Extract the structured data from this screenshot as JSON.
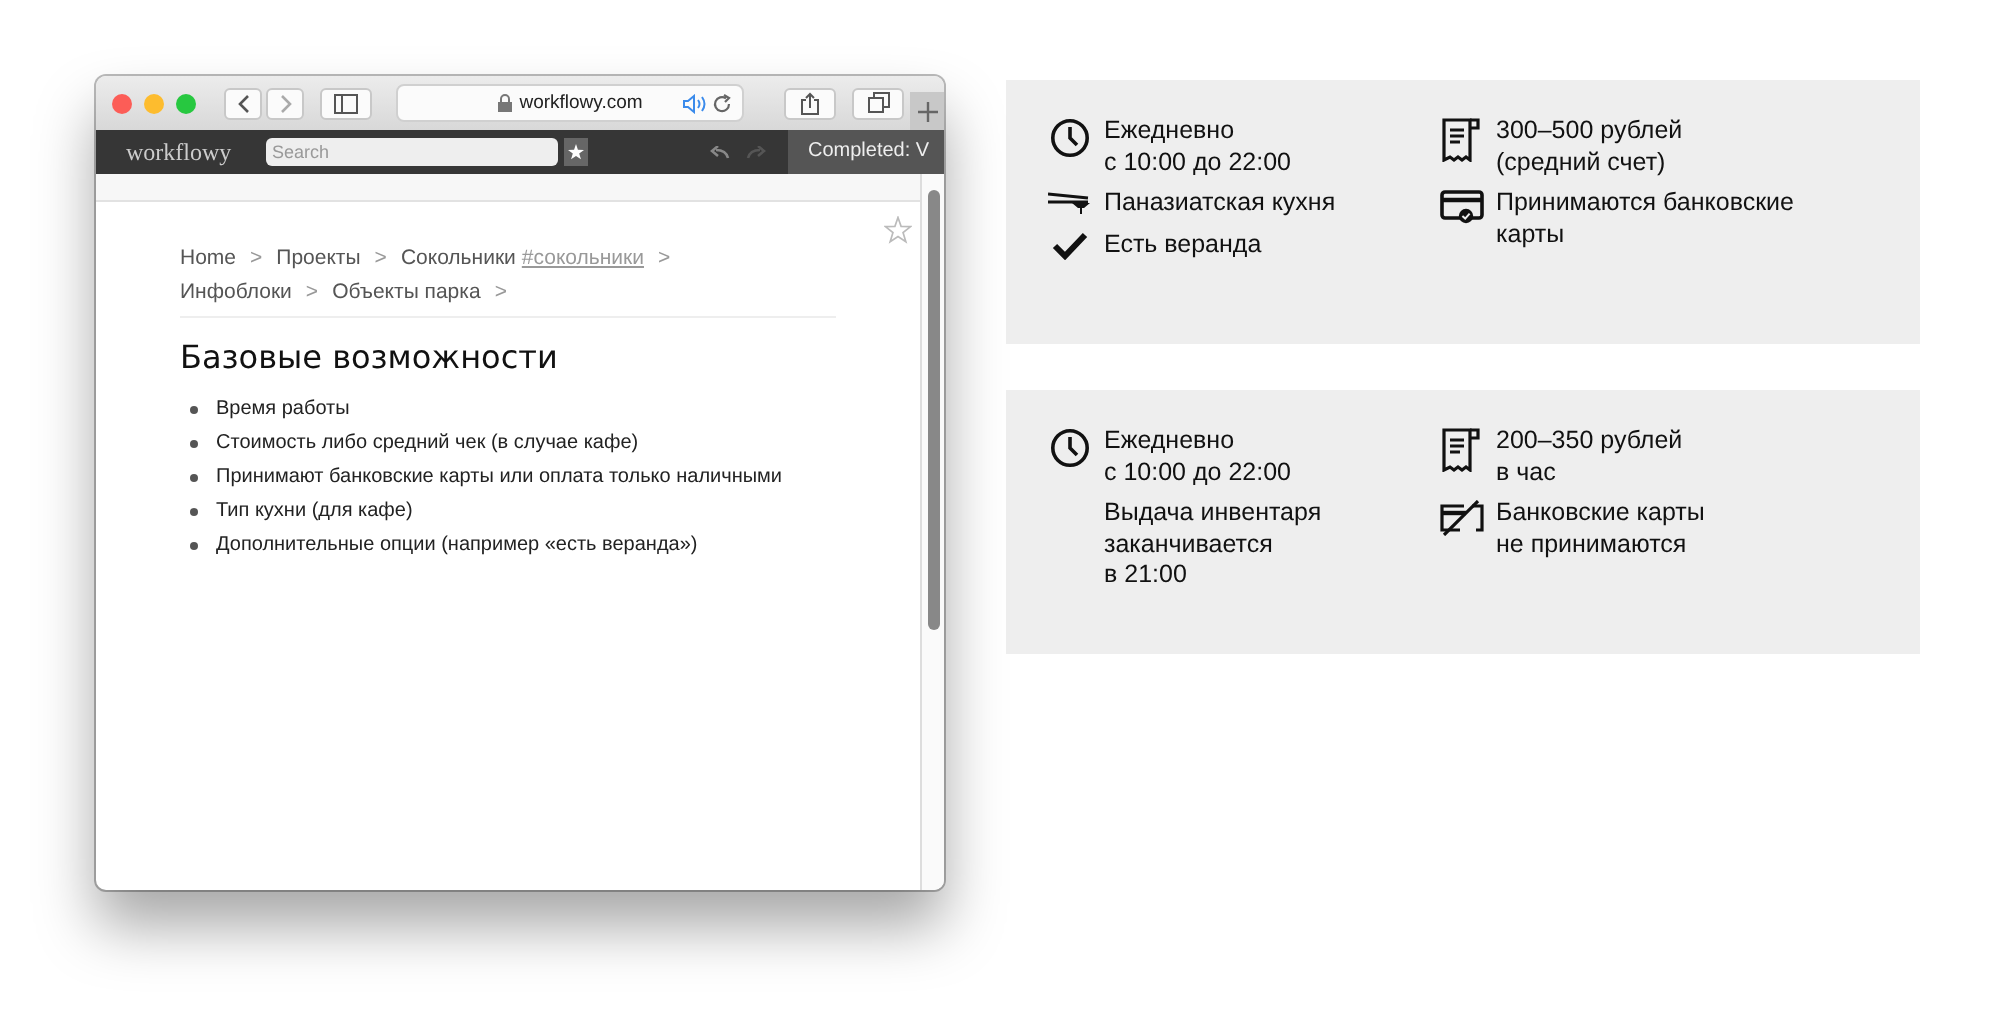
{
  "browser": {
    "url": "workflowy.com",
    "app_name": "workflowy",
    "search_placeholder": "Search",
    "completed_label": "Completed: V",
    "breadcrumb_lines": [
      [
        {
          "label": "Home",
          "sep": ">"
        },
        {
          "label": "Проекты",
          "sep": ">"
        },
        {
          "label": "Сокольники",
          "tag": "#сокольники",
          "sep": ">"
        }
      ],
      [
        {
          "label": "Инфоблоки",
          "sep": ">"
        },
        {
          "label": "Объекты парка",
          "sep": ">"
        }
      ]
    ],
    "title": "Базовые возможности",
    "bullets": [
      "Время работы",
      "Стоимость либо средний чек (в случае кафе)",
      "Принимают банковские карты или оплата только наличными",
      "Тип кухни (для кафе)",
      "Дополнительные опции (например «есть веранда»)"
    ]
  },
  "cards": [
    {
      "columns": [
        [
          {
            "kind": "clock",
            "text": "Ежедневно\nс 10:00 до 22:00"
          },
          {
            "kind": "cuisine",
            "text": "Паназиатская кухня"
          },
          {
            "kind": "check",
            "text": "Есть веранда"
          }
        ],
        [
          {
            "kind": "receipt",
            "text": "300–500 рублей\n(средний счет)"
          },
          {
            "kind": "card",
            "text": "Принимаются банковские\nкарты"
          }
        ]
      ]
    },
    {
      "columns": [
        [
          {
            "kind": "clock",
            "text": "Ежедневно\nс 10:00 до 22:00"
          },
          {
            "kind": "none",
            "text": "Выдача инвентаря\nзаканчивается\nв 21:00"
          }
        ],
        [
          {
            "kind": "receipt",
            "text": "200–350 рублей\nв час"
          },
          {
            "kind": "no-card",
            "text": "Банковские карты\nне принимаются"
          }
        ]
      ]
    }
  ]
}
